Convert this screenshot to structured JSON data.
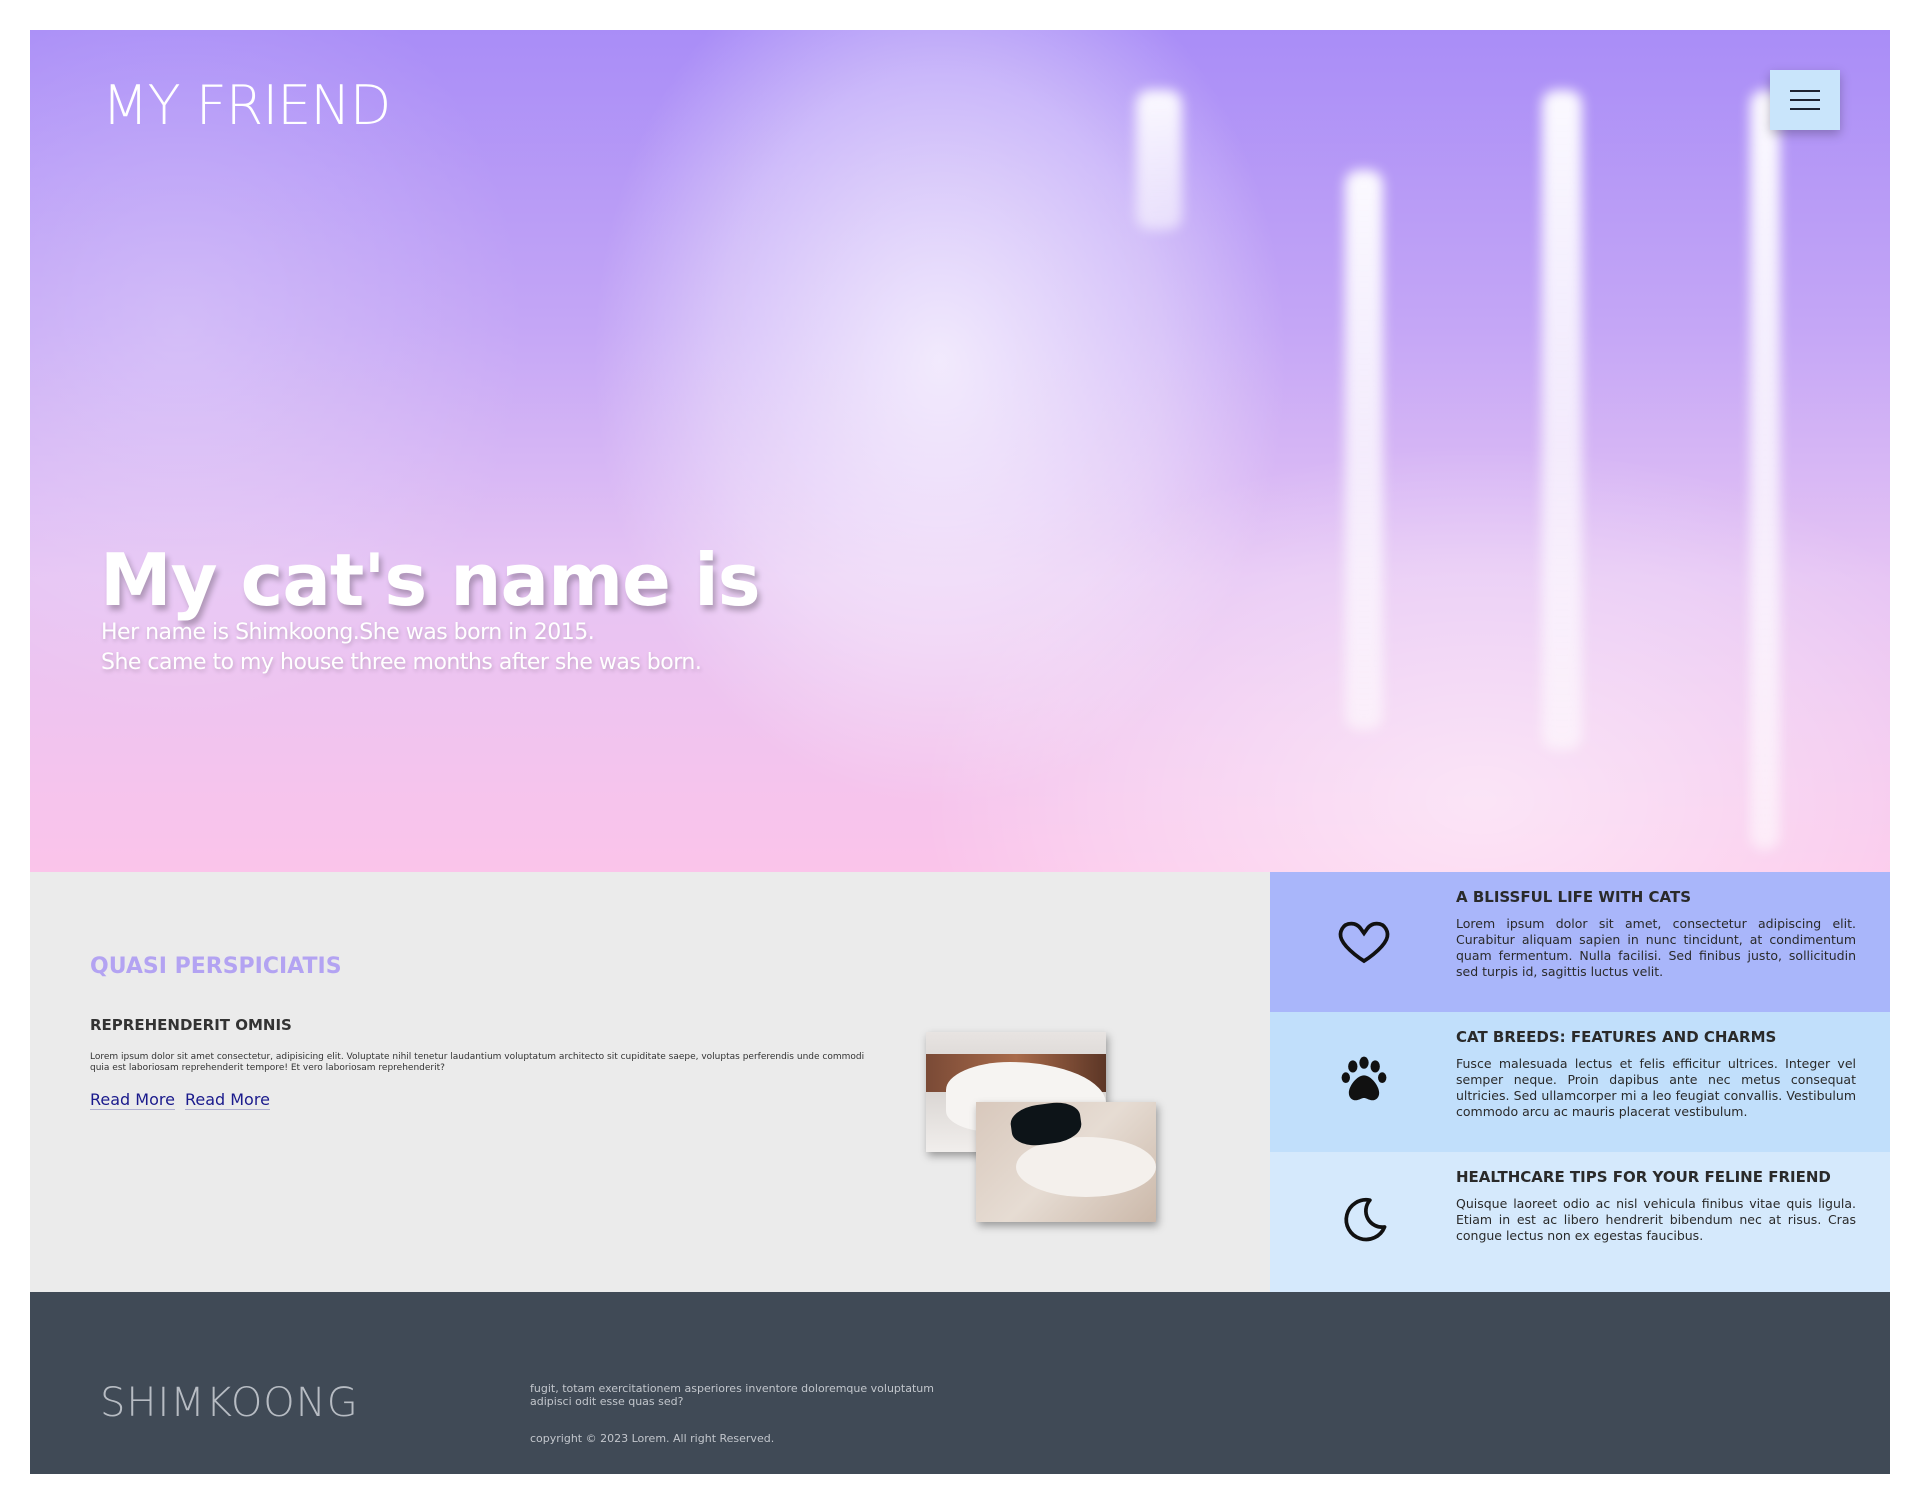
{
  "header": {
    "logo": "MY FRIEND",
    "menu_icon": "hamburger-menu-icon"
  },
  "hero": {
    "title": "My cat's name is",
    "subtitle_line1": "Her name is Shimkoong.She was born in 2015.",
    "subtitle_line2": "She came to my house three months after she was born."
  },
  "about": {
    "heading": "QUASI PERSPICIATIS",
    "subheading": "REPREHENDERIT OMNIS",
    "text": "Lorem ipsum dolor sit amet consectetur, adipisicing elit. Voluptate nihil tenetur laudantium voluptatum architecto sit cupiditate saepe, voluptas perferendis unde commodi quia est laboriosam reprehenderit tempore! Et vero laboriosam reprehenderit?",
    "links": [
      "Read More",
      "Read More"
    ]
  },
  "features": [
    {
      "icon": "heart-icon",
      "title": "A BLISSFUL LIFE WITH CATS",
      "text": "Lorem ipsum dolor sit amet, consectetur adipiscing elit. Curabitur aliquam sapien in nunc tincidunt, at condimentum quam fermentum. Nulla facilisi. Sed finibus justo, sollicitudin sed turpis id, sagittis luctus velit."
    },
    {
      "icon": "paw-icon",
      "title": "CAT BREEDS: FEATURES AND CHARMS",
      "text": "Fusce malesuada lectus et felis efficitur ultrices. Integer vel semper neque. Proin dapibus ante nec metus consequat ultricies. Sed ullamcorper mi a leo feugiat convallis. Vestibulum commodo arcu ac mauris placerat vestibulum."
    },
    {
      "icon": "moon-icon",
      "title": "HEALTHCARE TIPS FOR YOUR FELINE FRIEND",
      "text": "Quisque laoreet odio ac nisl vehicula finibus vitae quis ligula. Etiam in est ac libero hendrerit bibendum nec at risus. Cras congue lectus non ex egestas faucibus."
    }
  ],
  "footer": {
    "logo": "SHIMKOONG",
    "text": "fugit, totam exercitationem asperiores inventore doloremque voluptatum adipisci odit esse quas sed?",
    "copyright": "copyright © 2023 Lorem. All right Reserved."
  },
  "colors": {
    "hero_top": "#a98df7",
    "hero_bottom": "#fbc4ea",
    "menu_button": "#c9e5fb",
    "about_bg": "#ebebeb",
    "heading_accent": "#b3a3f2",
    "feature1_bg": "#a9b6fa",
    "feature2_bg": "#c1dffb",
    "feature3_bg": "#d5e9fc",
    "footer_bg": "#404a56"
  }
}
